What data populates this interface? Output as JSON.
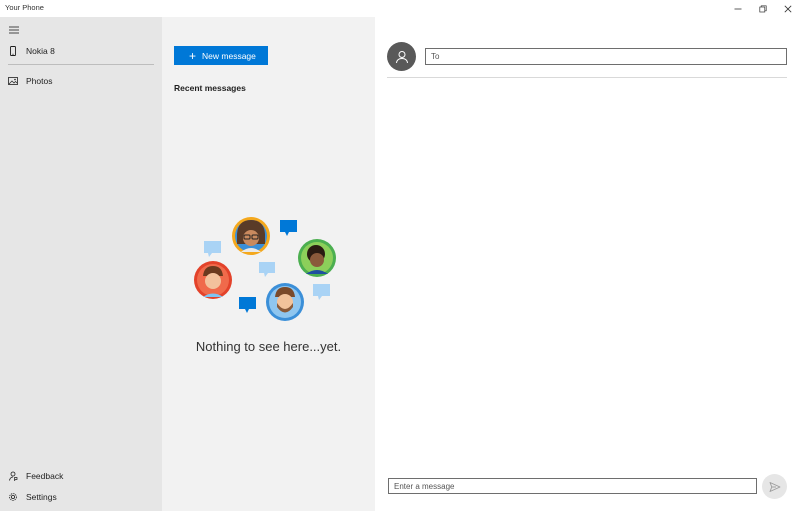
{
  "window": {
    "title": "Your Phone"
  },
  "nav": {
    "device": {
      "label": "Nokia 8",
      "icon": "phone-icon"
    },
    "items": [
      {
        "label": "Photos",
        "icon": "photos-icon"
      }
    ],
    "footer": [
      {
        "label": "Feedback",
        "icon": "feedback-icon"
      },
      {
        "label": "Settings",
        "icon": "gear-icon"
      }
    ]
  },
  "messages": {
    "new_message_label": "New message",
    "recent_label": "Recent messages",
    "empty_text": "Nothing to see here...yet."
  },
  "compose": {
    "to_placeholder": "To",
    "message_placeholder": "Enter a message"
  },
  "colors": {
    "accent": "#0078d7",
    "nav_bg": "#e6e6e6",
    "list_bg": "#f2f2f2"
  }
}
